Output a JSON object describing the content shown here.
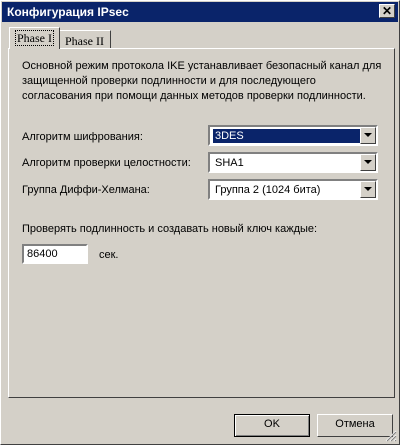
{
  "window": {
    "title": "Конфигурация IPsec",
    "close_glyph": "✕"
  },
  "tabs": [
    {
      "label": "Phase I",
      "active": true
    },
    {
      "label": "Phase II",
      "active": false
    }
  ],
  "phase1": {
    "description": "Основной режим протокола IKE устанавливает безопасный канал для защищенной проверки подлинности и для последующего согласования при помощи данных методов проверки подлинности.",
    "encryption": {
      "label": "Алгоритм шифрования:",
      "value": "3DES"
    },
    "integrity": {
      "label": "Алгоритм проверки целостности:",
      "value": "SHA1"
    },
    "dh_group": {
      "label": "Группа Диффи-Хелмана:",
      "value": "Группа 2 (1024 бита)"
    },
    "rekey": {
      "label": "Проверять подлинность и создавать новый ключ каждые:",
      "value": "86400",
      "unit": "сек."
    }
  },
  "buttons": {
    "ok": "OK",
    "cancel": "Отмена"
  },
  "colors": {
    "titlebar": "#0a246a",
    "face": "#d4d0c8",
    "selection": "#0a246a"
  }
}
